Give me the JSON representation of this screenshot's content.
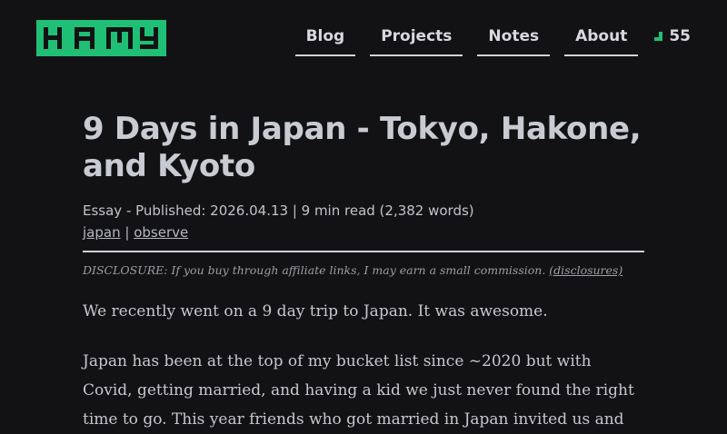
{
  "header": {
    "logo_text": "HAMY",
    "nav": [
      "Blog",
      "Projects",
      "Notes",
      "About"
    ],
    "counter": "55"
  },
  "article": {
    "title": "9 Days in Japan - Tokyo, Hakone, and Kyoto",
    "meta": "Essay - Published: 2026.04.13 | 9 min read (2,382 words)",
    "tags": [
      "japan",
      "observe"
    ],
    "tag_separator": "|",
    "disclosure": "DISCLOSURE: If you buy through affiliate links, I may earn a small commission.",
    "disclosure_link": "(disclosures)",
    "paragraphs": [
      "We recently went on a 9 day trip to Japan. It was awesome.",
      "Japan has been at the top of my bucket list since ~2020 but with Covid, getting married, and having a kid we just never found the right time to go. This year friends who got married in Japan invited us and"
    ]
  },
  "colors": {
    "background": "#121214",
    "accent": "#1fbf75",
    "text": "#c9cbd1"
  },
  "icons": [
    "counter-icon"
  ]
}
